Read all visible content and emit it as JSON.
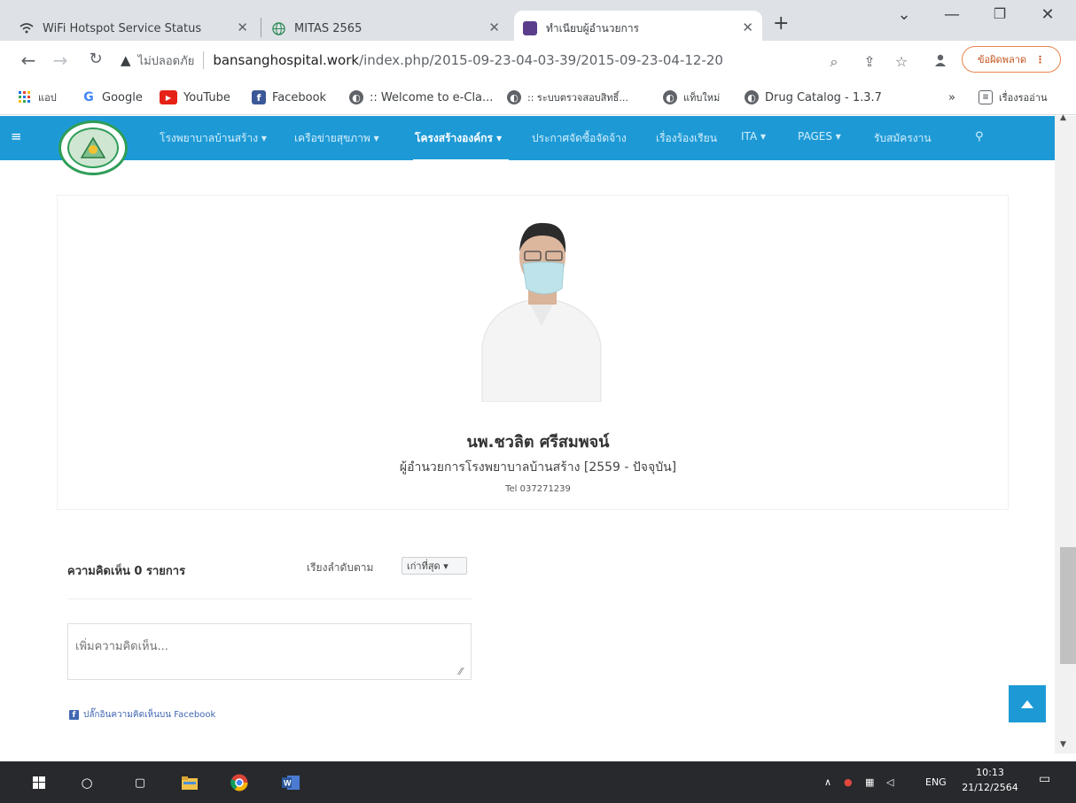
{
  "browser": {
    "tabs": [
      {
        "title": "WiFi Hotspot Service Status",
        "icon": "wifi-icon"
      },
      {
        "title": "MITAS 2565",
        "icon": "globe-icon"
      },
      {
        "title": "ทำเนียบผู้อำนวยการ",
        "icon": "site-favicon"
      }
    ],
    "new_tab_label": "+",
    "insecure_label": "ไม่ปลอดภัย",
    "url_domain": "bansanghospital.work",
    "url_path": "/index.php/2015-09-23-04-03-39/2015-09-23-04-12-20",
    "error_button": "ข้อผิดพลาด"
  },
  "bookmarks": {
    "apps": "แอป",
    "items": [
      {
        "label": "Google",
        "icon": "google-icon"
      },
      {
        "label": "YouTube",
        "icon": "youtube-icon"
      },
      {
        "label": "Facebook",
        "icon": "facebook-icon"
      },
      {
        "label": ":: Welcome to e-Cla...",
        "icon": "globe-icon"
      },
      {
        "label": ":: ระบบตรวจสอบสิทธิ์...",
        "icon": "globe-icon"
      },
      {
        "label": "แท็บใหม่",
        "icon": "globe-icon"
      },
      {
        "label": "Drug Catalog - 1.3.7",
        "icon": "globe-icon"
      }
    ],
    "more": "»",
    "reading_list": "เรื่องรออ่าน"
  },
  "site_nav": {
    "menu_icon": "menu-icon",
    "items": [
      "โรงพยาบาลบ้านสร้าง ▾",
      "เครือข่ายสุขภาพ ▾",
      "โครงสร้างองค์กร ▾",
      "ประกาศจัดซื้อจัดจ้าง",
      "เรื่องร้องเรียน",
      "ITA ▾",
      "PAGES ▾",
      "รับสมัครงาน"
    ],
    "active_index": 2
  },
  "profile": {
    "name": "นพ.ชวลิต ศรีสมพจน์",
    "position": "ผู้อำนวยการโรงพยาบาลบ้านสร้าง  [2559 - ปัจจุบัน]",
    "tel": "Tel 037271239"
  },
  "comments": {
    "count_label": "ความคิดเห็น 0 รายการ",
    "sort_label": "เรียงลำดับตาม",
    "sort_value": "เก่าที่สุด ▾",
    "placeholder": "เพิ่มความคิดเห็น...",
    "plugin_label": "ปลั๊กอินความคิดเห็นบน Facebook"
  },
  "taskbar": {
    "lang": "ENG",
    "time": "10:13",
    "date": "21/12/2564"
  },
  "colors": {
    "nav_blue": "#1d9ad6",
    "error_orange": "#c5521c",
    "facebook_blue": "#4267b2"
  }
}
